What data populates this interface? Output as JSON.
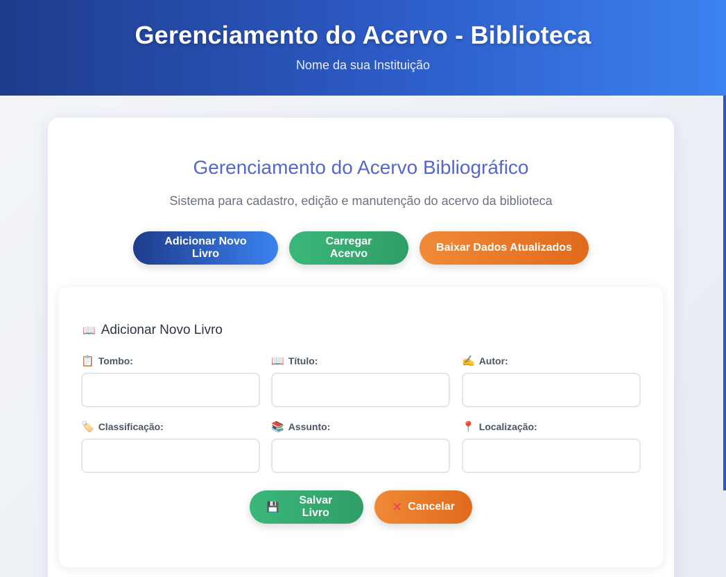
{
  "header": {
    "title": "Gerenciamento do Acervo - Biblioteca",
    "subtitle": "Nome da sua Instituição"
  },
  "main": {
    "title": "Gerenciamento do Acervo Bibliográfico",
    "subtitle": "Sistema para cadastro, edição e manutenção do acervo da biblioteca",
    "actions": {
      "add_book": "Adicionar Novo Livro",
      "load_collection": "Carregar Acervo",
      "download_data": "Baixar Dados Atualizados"
    }
  },
  "form": {
    "icon": "📖",
    "title": "Adicionar Novo Livro",
    "fields": [
      {
        "icon": "📋",
        "label": "Tombo:",
        "value": "",
        "placeholder": ""
      },
      {
        "icon": "📖",
        "label": "Título:",
        "value": "",
        "placeholder": ""
      },
      {
        "icon": "✍️",
        "label": "Autor:",
        "value": "",
        "placeholder": ""
      },
      {
        "icon": "🏷️",
        "label": "Classificação:",
        "value": "",
        "placeholder": ""
      },
      {
        "icon": "📚",
        "label": "Assunto:",
        "value": "",
        "placeholder": ""
      },
      {
        "icon": "📍",
        "label": "Localização:",
        "value": "",
        "placeholder": ""
      }
    ],
    "save": {
      "icon": "💾",
      "label": "Salvar Livro"
    },
    "cancel": {
      "icon": "✕",
      "label": "Cancelar"
    }
  },
  "colors": {
    "header_start": "#1e3c8c",
    "header_end": "#3b82f0",
    "title_accent": "#5566cc",
    "green": "#3bb77a",
    "orange": "#f08a36"
  }
}
